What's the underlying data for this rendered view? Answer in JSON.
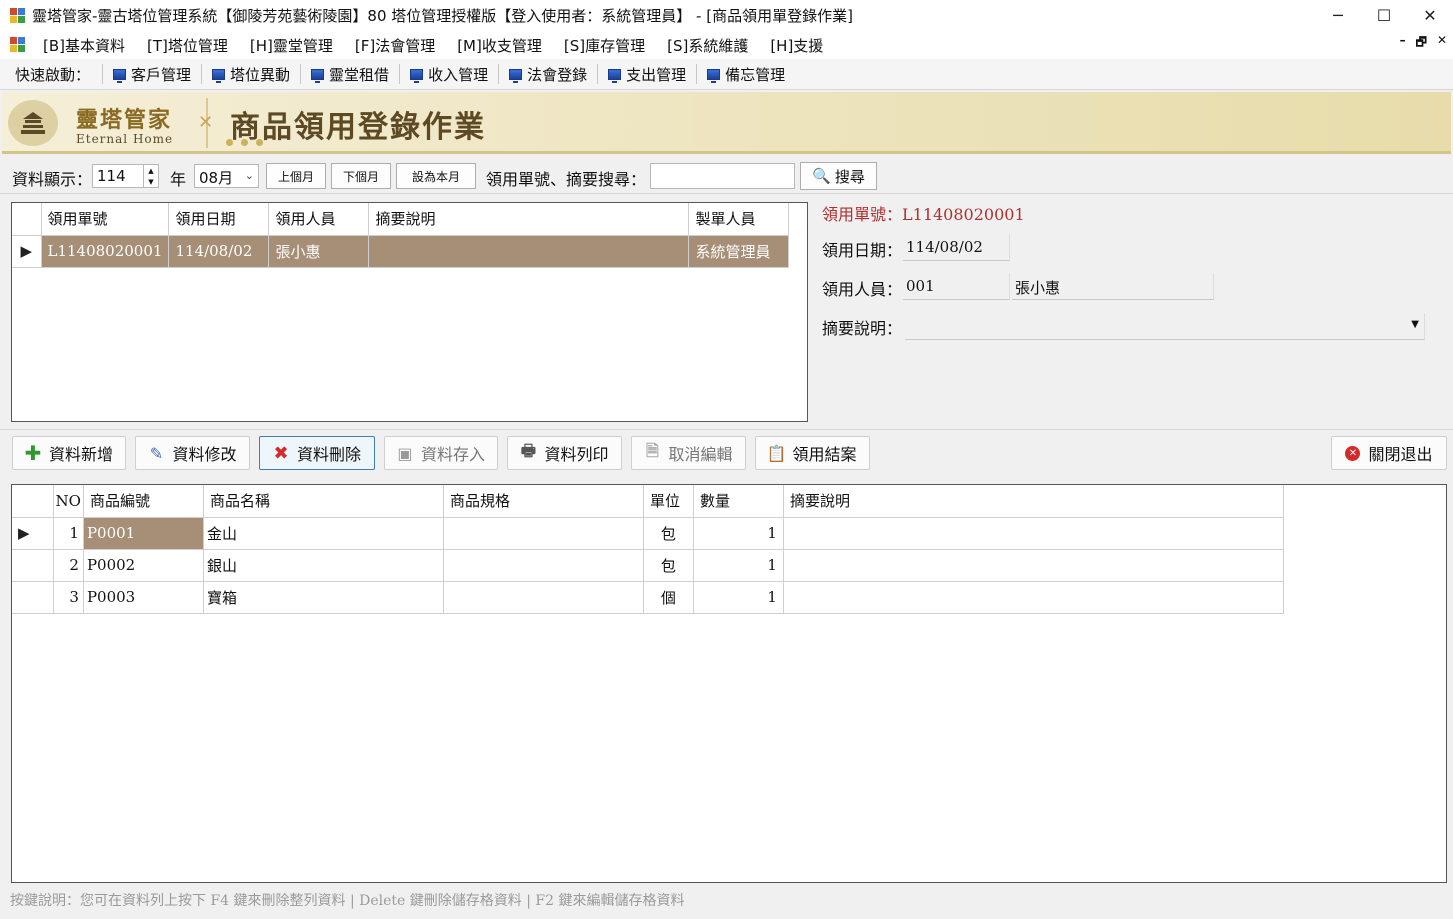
{
  "window": {
    "title": "靈塔管家-靈古塔位管理系統【御陵芳苑藝術陵園】80 塔位管理授權版【登入使用者：系統管理員】 - [商品領用單登錄作業]",
    "minimize": "─",
    "maximize": "☐",
    "close": "✕"
  },
  "menu": {
    "items": [
      "[B]基本資料",
      "[T]塔位管理",
      "[H]靈堂管理",
      "[F]法會管理",
      "[M]收支管理",
      "[S]庫存管理",
      "[S]系統維護",
      "[H]支援"
    ],
    "mdi": [
      "–",
      "🗗",
      "✕"
    ]
  },
  "quickbar": {
    "label": "快速啟動：",
    "items": [
      "客戶管理",
      "塔位異動",
      "靈堂租借",
      "收入管理",
      "法會登錄",
      "支出管理",
      "備忘管理"
    ]
  },
  "banner": {
    "brand_zh": "靈塔管家",
    "brand_en": "Eternal Home",
    "page_title": "商品領用登錄作業"
  },
  "filter": {
    "display_label": "資料顯示：",
    "year_value": "114",
    "year_label": "年",
    "month_value": "08月",
    "prev_month": "上個月",
    "next_month": "下個月",
    "this_month": "設為本月",
    "search_label": "領用單號、摘要搜尋：",
    "search_value": "",
    "search_button": "搜尋"
  },
  "orders": {
    "columns": [
      "領用單號",
      "領用日期",
      "領用人員",
      "摘要說明",
      "製單人員"
    ],
    "rows": [
      {
        "no": "L11408020001",
        "date": "114/08/02",
        "person": "張小惠",
        "memo": "",
        "maker": "系統管理員"
      }
    ]
  },
  "detail": {
    "order_no_label": "領用單號：",
    "order_no": "L11408020001",
    "date_label": "領用日期：",
    "date": "114/08/02",
    "person_label": "領用人員：",
    "person_code": "001",
    "person_name": "張小惠",
    "memo_label": "摘要說明：",
    "memo": ""
  },
  "actions": {
    "add": "資料新增",
    "edit": "資料修改",
    "delete": "資料刪除",
    "save": "資料存入",
    "print": "資料列印",
    "cancel": "取消編輯",
    "close_order": "領用結案",
    "exit": "關閉退出"
  },
  "items": {
    "columns": [
      "NO",
      "商品編號",
      "商品名稱",
      "商品規格",
      "單位",
      "數量",
      "摘要說明"
    ],
    "rows": [
      {
        "no": "1",
        "code": "P0001",
        "name": "金山",
        "spec": "",
        "unit": "包",
        "qty": "1",
        "memo": ""
      },
      {
        "no": "2",
        "code": "P0002",
        "name": "銀山",
        "spec": "",
        "unit": "包",
        "qty": "1",
        "memo": ""
      },
      {
        "no": "3",
        "code": "P0003",
        "name": "寶箱",
        "spec": "",
        "unit": "個",
        "qty": "1",
        "memo": ""
      }
    ]
  },
  "footer": {
    "hint": "按鍵說明：您可在資料列上按下 F4 鍵來刪除整列資料 | Delete 鍵刪除儲存格資料 | F2 鍵來編輯儲存格資料"
  },
  "colors": {
    "selected_row": "#a68f76",
    "banner_title": "#5d4a24",
    "order_no_red": "#b03030"
  }
}
